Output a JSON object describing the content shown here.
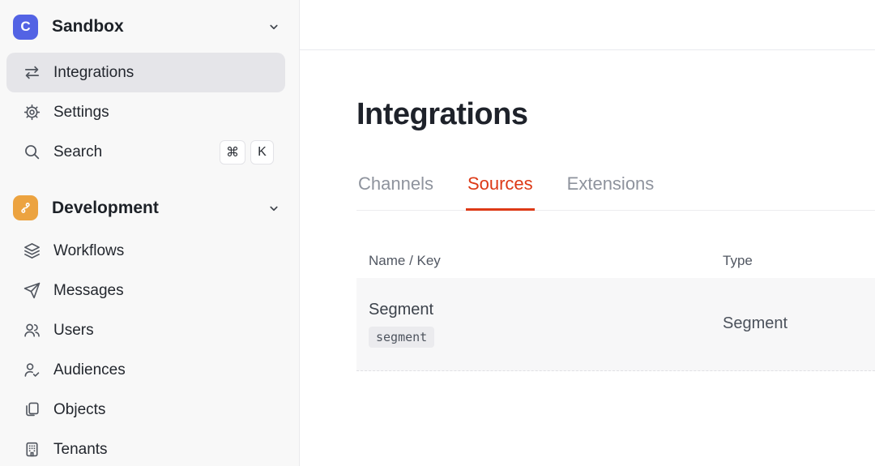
{
  "workspace": {
    "logo_letter": "C",
    "name": "Sandbox"
  },
  "sidebar": {
    "top_items": [
      {
        "label": "Integrations",
        "icon": "swap-arrows-icon",
        "active": true
      },
      {
        "label": "Settings",
        "icon": "gear-icon",
        "active": false
      },
      {
        "label": "Search",
        "icon": "search-icon",
        "active": false,
        "shortcut": [
          "⌘",
          "K"
        ]
      }
    ],
    "section": {
      "label": "Development",
      "icon": "branch-icon"
    },
    "items": [
      {
        "label": "Workflows",
        "icon": "layers-icon"
      },
      {
        "label": "Messages",
        "icon": "paper-plane-icon"
      },
      {
        "label": "Users",
        "icon": "users-icon"
      },
      {
        "label": "Audiences",
        "icon": "person-check-icon"
      },
      {
        "label": "Objects",
        "icon": "copy-pages-icon"
      },
      {
        "label": "Tenants",
        "icon": "building-icon"
      }
    ]
  },
  "main": {
    "title": "Integrations",
    "tabs": [
      {
        "label": "Channels",
        "active": false
      },
      {
        "label": "Sources",
        "active": true
      },
      {
        "label": "Extensions",
        "active": false
      }
    ],
    "table": {
      "columns": [
        "Name / Key",
        "Type"
      ],
      "rows": [
        {
          "name": "Segment",
          "key": "segment",
          "type": "Segment"
        }
      ]
    }
  },
  "colors": {
    "brand_blue": "#5363e4",
    "dev_orange": "#eca340",
    "accent_red": "#dd3916",
    "sidebar_bg": "#f8f8f8",
    "active_item_bg": "#e5e5e9",
    "row_bg": "#f7f7f8"
  }
}
